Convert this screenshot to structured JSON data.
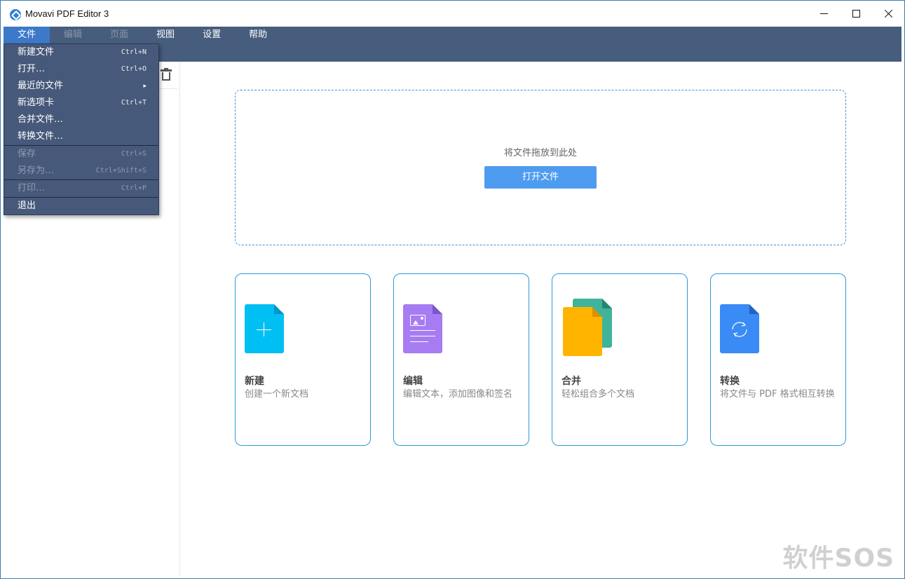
{
  "window": {
    "title": "Movavi PDF Editor 3",
    "controls": {
      "minimize": "minimize-icon",
      "maximize": "maximize-icon",
      "close": "close-icon"
    }
  },
  "menubar": {
    "items": [
      {
        "label": "文件",
        "active": true,
        "enabled": true
      },
      {
        "label": "编辑",
        "active": false,
        "enabled": false
      },
      {
        "label": "页面",
        "active": false,
        "enabled": false
      },
      {
        "label": "视图",
        "active": false,
        "enabled": true
      },
      {
        "label": "设置",
        "active": false,
        "enabled": true
      },
      {
        "label": "帮助",
        "active": false,
        "enabled": true
      }
    ]
  },
  "file_menu": {
    "groups": [
      [
        {
          "label": "新建文件",
          "shortcut": "Ctrl+N",
          "enabled": true
        },
        {
          "label": "打开…",
          "shortcut": "Ctrl+O",
          "enabled": true
        },
        {
          "label": "最近的文件",
          "submenu": true,
          "enabled": true
        },
        {
          "label": "新选项卡",
          "shortcut": "Ctrl+T",
          "enabled": true
        },
        {
          "label": "合并文件…",
          "shortcut": "",
          "enabled": true
        },
        {
          "label": "转换文件…",
          "shortcut": "",
          "enabled": true
        }
      ],
      [
        {
          "label": "保存",
          "shortcut": "Ctrl+S",
          "enabled": false
        },
        {
          "label": "另存为…",
          "shortcut": "Ctrl+Shift+S",
          "enabled": false
        }
      ],
      [
        {
          "label": "打印…",
          "shortcut": "Ctrl+P",
          "enabled": false
        }
      ],
      [
        {
          "label": "退出",
          "shortcut": "",
          "enabled": true
        }
      ]
    ]
  },
  "left_panel": {
    "trash_icon": "trash-icon"
  },
  "dropzone": {
    "text": "将文件拖放到此处",
    "button": "打开文件"
  },
  "cards": [
    {
      "title": "新建",
      "desc": "创建一个新文档",
      "icon": "new-document-icon",
      "color": "#00bff3"
    },
    {
      "title": "编辑",
      "desc": "编辑文本，添加图像和签名",
      "icon": "edit-document-icon",
      "color": "#a77cf2"
    },
    {
      "title": "合并",
      "desc": "轻松组合多个文档",
      "icon": "merge-documents-icon",
      "color": "#ffb400",
      "color2": "#3fb49a"
    },
    {
      "title": "转换",
      "desc": "将文件与 PDF 格式相互转换",
      "icon": "convert-document-icon",
      "color": "#3a8bf5"
    }
  ],
  "watermark": "软件SOS"
}
